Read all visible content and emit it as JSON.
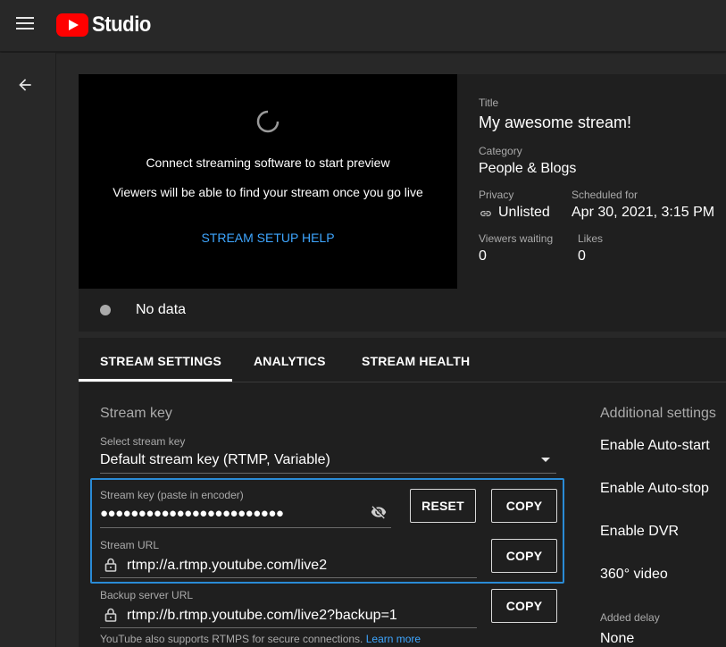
{
  "app": {
    "logo_text": "Studio"
  },
  "preview": {
    "line1": "Connect streaming software to start preview",
    "line2": "Viewers will be able to find your stream once you go live",
    "help_link": "STREAM SETUP HELP"
  },
  "info": {
    "title_label": "Title",
    "title_value": "My awesome stream!",
    "category_label": "Category",
    "category_value": "People & Blogs",
    "privacy_label": "Privacy",
    "privacy_value": "Unlisted",
    "scheduled_label": "Scheduled for",
    "scheduled_value": "Apr 30, 2021, 3:15 PM",
    "viewers_label": "Viewers waiting",
    "viewers_value": "0",
    "likes_label": "Likes",
    "likes_value": "0"
  },
  "status": {
    "text": "No data"
  },
  "tabs": [
    {
      "label": "STREAM SETTINGS",
      "active": true
    },
    {
      "label": "ANALYTICS",
      "active": false
    },
    {
      "label": "STREAM HEALTH",
      "active": false
    }
  ],
  "stream_key": {
    "section_title": "Stream key",
    "select_label": "Select stream key",
    "select_value": "Default stream key (RTMP, Variable)",
    "key_label": "Stream key (paste in encoder)",
    "key_value": "●●●●●●●●●●●●●●●●●●●●●●●●",
    "reset_button": "RESET",
    "copy_key_button": "COPY",
    "url_label": "Stream URL",
    "url_value": "rtmp://a.rtmp.youtube.com/live2",
    "copy_url_button": "COPY",
    "backup_label": "Backup server URL",
    "backup_value": "rtmp://b.rtmp.youtube.com/live2?backup=1",
    "copy_backup_button": "COPY",
    "footer_text": "YouTube also supports RTMPS for secure connections.",
    "learn_more": "Learn more"
  },
  "additional": {
    "title": "Additional settings",
    "items": [
      "Enable Auto-start",
      "Enable Auto-stop",
      "Enable DVR",
      "360° video"
    ],
    "delay_label": "Added delay",
    "delay_value": "None"
  },
  "colors": {
    "accent": "#3ea6ff",
    "highlight": "#2a8bd6",
    "brand": "#ff0000"
  }
}
